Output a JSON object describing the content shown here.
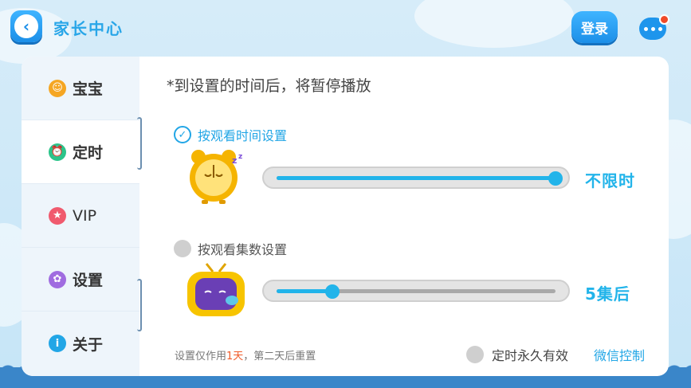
{
  "header": {
    "title": "家长中心",
    "login_label": "登录"
  },
  "sidebar": {
    "items": [
      {
        "label": "宝宝",
        "icon": "smiley-icon",
        "color": "#f5a623",
        "active": false
      },
      {
        "label": "定时",
        "icon": "alarm-clock-icon",
        "color": "#2bc48a",
        "active": true
      },
      {
        "label": "VIP",
        "icon": "star-badge-icon",
        "color": "#f05a6e",
        "active": false
      },
      {
        "label": "设置",
        "icon": "gear-icon",
        "color": "#a06ce0",
        "active": false
      },
      {
        "label": "关于",
        "icon": "info-icon",
        "color": "#22a6e6",
        "active": false
      }
    ]
  },
  "main": {
    "note": "*到设置的时间后，将暂停播放",
    "time_option": {
      "label": "按观看时间设置",
      "selected": true,
      "slider_level": 1.0,
      "value_text": "不限时"
    },
    "episode_option": {
      "label": "按观看集数设置",
      "selected": false,
      "slider_level": 0.2,
      "value_text": "5集后"
    },
    "footer": {
      "note_prefix": "设置仅作用",
      "note_highlight": "1天",
      "note_suffix": "，第二天后重置",
      "forever_label": "定时永久有效",
      "wechat_label": "微信控制"
    }
  },
  "colors": {
    "accent": "#22a6e6",
    "warning": "#f05a28"
  }
}
